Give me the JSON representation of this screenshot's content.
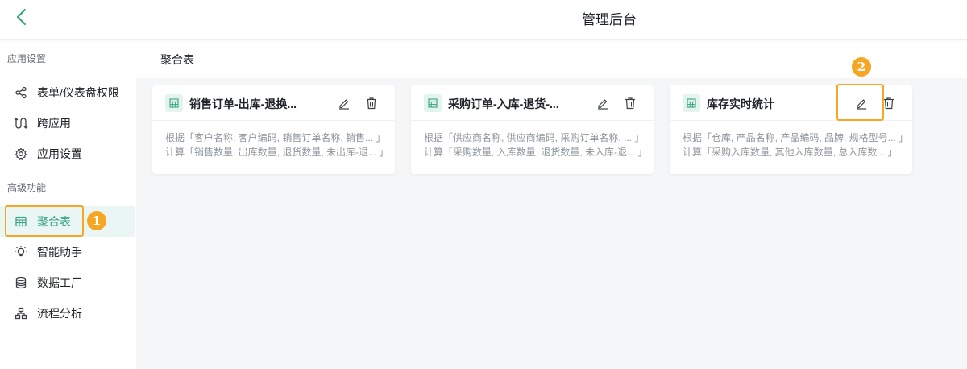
{
  "header": {
    "title": "管理后台",
    "back_icon": "chevron-left-icon"
  },
  "sidebar": {
    "groups": [
      {
        "label": "应用设置"
      },
      {
        "label": "高级功能"
      }
    ],
    "items": [
      {
        "label": "表单/仪表盘权限",
        "icon": "share-icon"
      },
      {
        "label": "跨应用",
        "icon": "cross-app-icon"
      },
      {
        "label": "应用设置",
        "icon": "gear-icon"
      },
      {
        "label": "聚合表",
        "icon": "table-icon",
        "active": true
      },
      {
        "label": "智能助手",
        "icon": "lightbulb-icon"
      },
      {
        "label": "数据工厂",
        "icon": "database-icon"
      },
      {
        "label": "流程分析",
        "icon": "flowchart-icon"
      }
    ]
  },
  "annotations": {
    "marker1": "1",
    "marker2": "2",
    "highlight_color": "#f5a623"
  },
  "main": {
    "title": "聚合表",
    "cards": [
      {
        "title": "销售订单-出库-退换...",
        "line1": "根据「客户名称, 客户编码, 销售订单名称, 销售... 」",
        "line2": "计算「销售数量, 出库数量, 退货数量, 未出库-退... 」"
      },
      {
        "title": "采购订单-入库-退货-...",
        "line1": "根据「供应商名称, 供应商编码, 采购订单名称, ... 」",
        "line2": "计算「采购数量, 入库数量, 退货数量, 未入库-退... 」"
      },
      {
        "title": "库存实时统计",
        "line1": "根据「仓库, 产品名称, 产品编码, 品牌, 规格型号... 」",
        "line2": "计算「采购入库数量, 其他入库数量, 总入库数... 」"
      }
    ]
  },
  "colors": {
    "accent": "#3aa385",
    "active_bg": "#eaf6f3",
    "back_icon": "#3aa385"
  }
}
